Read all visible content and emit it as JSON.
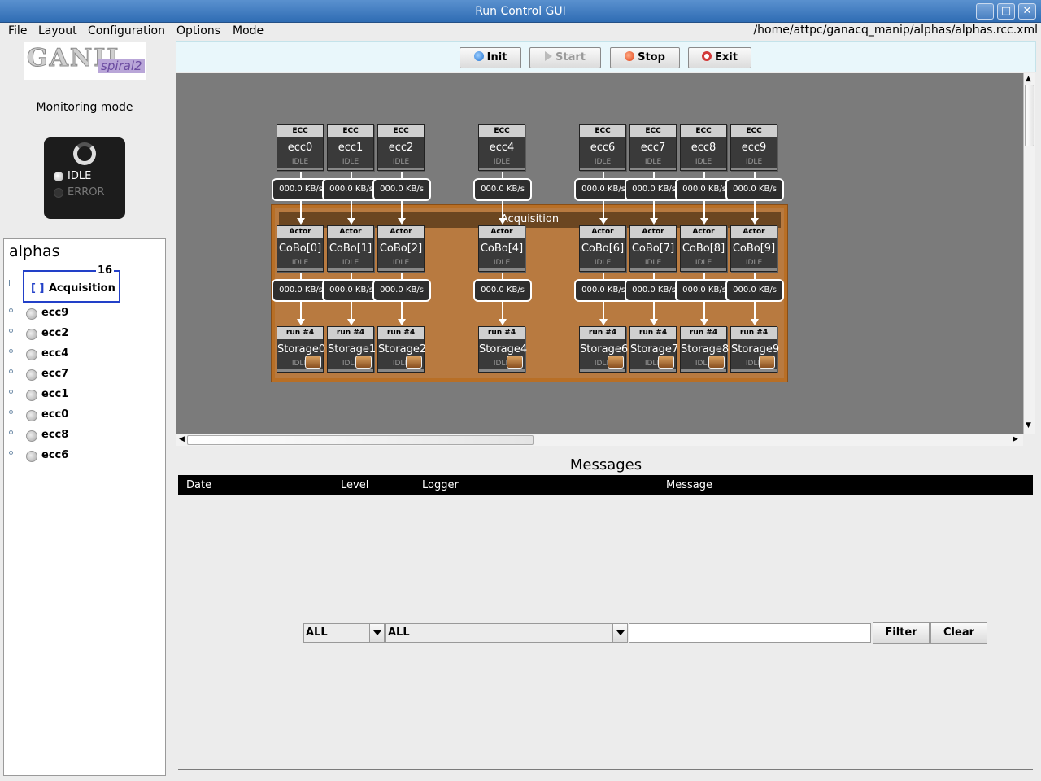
{
  "window": {
    "title": "Run Control GUI"
  },
  "menu": [
    "File",
    "Layout",
    "Configuration",
    "Options",
    "Mode"
  ],
  "config_path": "/home/attpc/ganacq_manip/alphas/alphas.rcc.xml",
  "logo": {
    "main": "GANIL",
    "sub": "spiral2"
  },
  "monitor": {
    "mode_label": "Monitoring mode",
    "states": [
      {
        "label": "IDLE",
        "active": true
      },
      {
        "label": "ERROR",
        "active": false
      }
    ]
  },
  "tree": {
    "root": "alphas",
    "acquisition": {
      "label": "Acquisition",
      "bracket": "[ ]",
      "count": "16"
    },
    "items": [
      "ecc9",
      "ecc2",
      "ecc4",
      "ecc7",
      "ecc1",
      "ecc0",
      "ecc8",
      "ecc6"
    ]
  },
  "toolbar": {
    "init": "Init",
    "start": "Start",
    "stop": "Stop",
    "exit": "Exit"
  },
  "diagram": {
    "group_label": "Acquisition",
    "ecc_header": "ECC",
    "actor_header": "Actor",
    "state": "IDLE",
    "rate": "000.0 KB/s",
    "ecc_nodes": [
      "ecc0",
      "ecc1",
      "ecc2",
      "ecc4",
      "ecc6",
      "ecc7",
      "ecc8",
      "ecc9"
    ],
    "cobo_nodes": [
      "CoBo[0]",
      "CoBo[1]",
      "CoBo[2]",
      "CoBo[4]",
      "CoBo[6]",
      "CoBo[7]",
      "CoBo[8]",
      "CoBo[9]"
    ],
    "storage_header": "run #4",
    "storage_nodes": [
      "Storage0",
      "Storage1",
      "Storage2",
      "Storage4",
      "Storage6",
      "Storage7",
      "Storage8",
      "Storage9"
    ]
  },
  "messages": {
    "title": "Messages",
    "columns": [
      "Date",
      "Level",
      "Logger",
      "Message"
    ],
    "level_filter": "ALL",
    "logger_filter": "ALL",
    "filter_text": "",
    "filter_button": "Filter",
    "clear_button": "Clear"
  },
  "colors": {
    "accent": "#2f6cb3",
    "group": "#b87a40",
    "node": "#3a3a3a",
    "canvas": "#7b7b7b"
  }
}
